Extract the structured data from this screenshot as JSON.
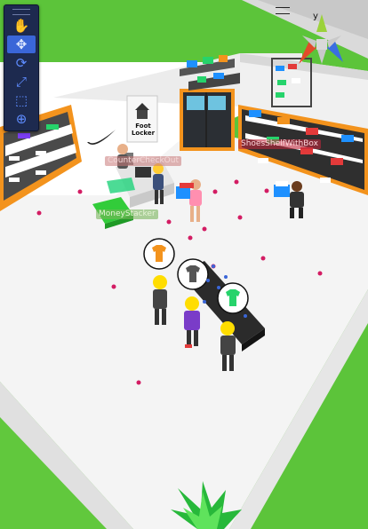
{
  "editor_tools": [
    {
      "name": "hand-tool",
      "glyph": "✋",
      "active": false
    },
    {
      "name": "move-tool",
      "glyph": "✥",
      "active": true
    },
    {
      "name": "rotate-tool",
      "glyph": "⟳",
      "active": false
    },
    {
      "name": "scale-tool",
      "glyph": "⤢",
      "active": false
    },
    {
      "name": "rect-tool",
      "glyph": "⬚",
      "active": false
    },
    {
      "name": "transform-tool",
      "glyph": "⊕",
      "active": false
    }
  ],
  "gizmo": {
    "axis_label": "y"
  },
  "store": {
    "sign": "Foot Locker",
    "labels": {
      "checkout": "CounterCheckOut",
      "money_stacker": "MoneyStacker",
      "shelf_right": "ShoesShelfWithBox"
    }
  },
  "colors": {
    "grass": "#5cc43a",
    "floor": "#f4f4f4",
    "trim": "#f3931d",
    "conveyor": "#2b2b2b",
    "editor_panel": "#1d2a4f",
    "editor_accent": "#3a66d8"
  }
}
